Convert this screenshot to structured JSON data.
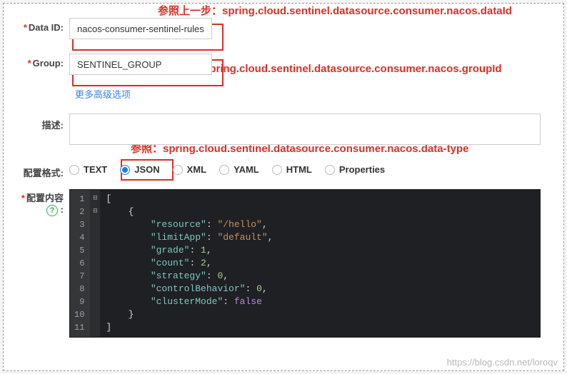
{
  "annotations": {
    "dataId": "参照上一步：spring.cloud.sentinel.datasource.consumer.nacos.dataId",
    "groupId": "参照：spring.cloud.sentinel.datasource.consumer.nacos.groupId",
    "dataType": "参照：spring.cloud.sentinel.datasource.consumer.nacos.data-type"
  },
  "labels": {
    "dataId": "Data ID:",
    "group": "Group:",
    "more": "更多高级选项",
    "desc": "描述:",
    "format": "配置格式:",
    "content": "配置内容",
    "help": "?"
  },
  "fields": {
    "dataId": "nacos-consumer-sentinel-rules",
    "group": "SENTINEL_GROUP",
    "desc": ""
  },
  "formats": {
    "options": [
      "TEXT",
      "JSON",
      "XML",
      "YAML",
      "HTML",
      "Properties"
    ],
    "selected": "JSON"
  },
  "editor": {
    "lines": [
      "1",
      "2",
      "3",
      "4",
      "5",
      "6",
      "7",
      "8",
      "9",
      "10",
      "11"
    ],
    "folds": [
      "⊟",
      "⊟",
      "",
      "",
      "",
      "",
      "",
      "",
      "",
      "",
      ""
    ],
    "code_raw": "[\n    {\n        \"resource\": \"/hello\",\n        \"limitApp\": \"default\",\n        \"grade\": 1,\n        \"count\": 2,\n        \"strategy\": 0,\n        \"controlBehavior\": 0,\n        \"clusterMode\": false\n    }\n]",
    "tokens": [
      [
        [
          "punc",
          "["
        ]
      ],
      [
        [
          "ind",
          "    "
        ],
        [
          "punc",
          "{"
        ]
      ],
      [
        [
          "ind",
          "        "
        ],
        [
          "key",
          "\"resource\""
        ],
        [
          "punc",
          ": "
        ],
        [
          "str",
          "\"/hello\""
        ],
        [
          "punc",
          ","
        ]
      ],
      [
        [
          "ind",
          "        "
        ],
        [
          "key",
          "\"limitApp\""
        ],
        [
          "punc",
          ": "
        ],
        [
          "str",
          "\"default\""
        ],
        [
          "punc",
          ","
        ]
      ],
      [
        [
          "ind",
          "        "
        ],
        [
          "key",
          "\"grade\""
        ],
        [
          "punc",
          ": "
        ],
        [
          "num",
          "1"
        ],
        [
          "punc",
          ","
        ]
      ],
      [
        [
          "ind",
          "        "
        ],
        [
          "key",
          "\"count\""
        ],
        [
          "punc",
          ": "
        ],
        [
          "num",
          "2"
        ],
        [
          "punc",
          ","
        ]
      ],
      [
        [
          "ind",
          "        "
        ],
        [
          "key",
          "\"strategy\""
        ],
        [
          "punc",
          ": "
        ],
        [
          "num",
          "0"
        ],
        [
          "punc",
          ","
        ]
      ],
      [
        [
          "ind",
          "        "
        ],
        [
          "key",
          "\"controlBehavior\""
        ],
        [
          "punc",
          ": "
        ],
        [
          "num",
          "0"
        ],
        [
          "punc",
          ","
        ]
      ],
      [
        [
          "ind",
          "        "
        ],
        [
          "key",
          "\"clusterMode\""
        ],
        [
          "punc",
          ": "
        ],
        [
          "bool",
          "false"
        ]
      ],
      [
        [
          "ind",
          "    "
        ],
        [
          "punc",
          "}"
        ]
      ],
      [
        [
          "punc",
          "]"
        ]
      ]
    ]
  },
  "watermark": "https://blog.csdn.net/loroqv"
}
